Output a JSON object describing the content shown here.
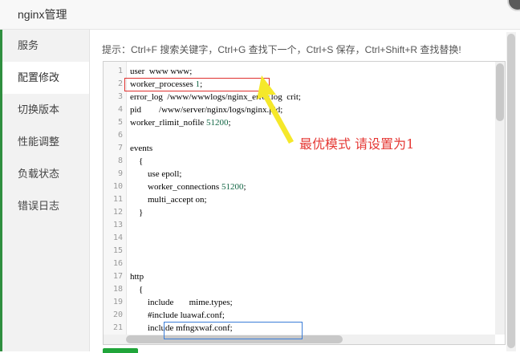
{
  "window": {
    "title": "nginx管理"
  },
  "sidebar": {
    "items": [
      {
        "label": "服务",
        "active": false
      },
      {
        "label": "配置修改",
        "active": true
      },
      {
        "label": "切换版本",
        "active": false
      },
      {
        "label": "性能调整",
        "active": false
      },
      {
        "label": "负载状态",
        "active": false
      },
      {
        "label": "错误日志",
        "active": false
      }
    ]
  },
  "hint": "提示：Ctrl+F 搜索关键字，Ctrl+G 查找下一个，Ctrl+S 保存，Ctrl+Shift+R 查找替换!",
  "editor": {
    "line_numbers": [
      "1",
      "2",
      "3",
      "4",
      "5",
      "6",
      "7",
      "8",
      "9",
      "10",
      "11",
      "12",
      "13",
      "14",
      "15",
      "16",
      "17",
      "18",
      "19",
      "20",
      "21"
    ],
    "lines": [
      {
        "text": "user  www www;",
        "num": ""
      },
      {
        "text": "worker_processes ",
        "num": "1",
        "tail": ";"
      },
      {
        "text": "error_log  /www/wwwlogs/nginx_error.log  crit;",
        "num": ""
      },
      {
        "text": "pid        /www/server/nginx/logs/nginx.pid;",
        "num": ""
      },
      {
        "text": "worker_rlimit_nofile ",
        "num": "51200",
        "tail": ";"
      },
      {
        "text": "",
        "num": ""
      },
      {
        "text": "events",
        "num": ""
      },
      {
        "text": "    {",
        "num": ""
      },
      {
        "text": "        use epoll;",
        "num": ""
      },
      {
        "text": "        worker_connections ",
        "num": "51200",
        "tail": ";"
      },
      {
        "text": "        multi_accept on;",
        "num": ""
      },
      {
        "text": "    }",
        "num": ""
      },
      {
        "text": "",
        "num": ""
      },
      {
        "text": "",
        "num": ""
      },
      {
        "text": "",
        "num": ""
      },
      {
        "text": "",
        "num": ""
      },
      {
        "text": "http",
        "num": ""
      },
      {
        "text": "    {",
        "num": ""
      },
      {
        "text": "        include       mime.types;",
        "num": ""
      },
      {
        "text": "        #include luawaf.conf;",
        "num": ""
      },
      {
        "text": "        include mfngxwaf.conf;",
        "num": ""
      }
    ]
  },
  "annotation": {
    "text": "最优模式  请设置为1",
    "color": "#e53935"
  },
  "colors": {
    "accent_green": "#20a53a",
    "highlight_red": "#e0312f",
    "highlight_blue": "#3b7dd8",
    "arrow_yellow": "#f5e82a"
  }
}
